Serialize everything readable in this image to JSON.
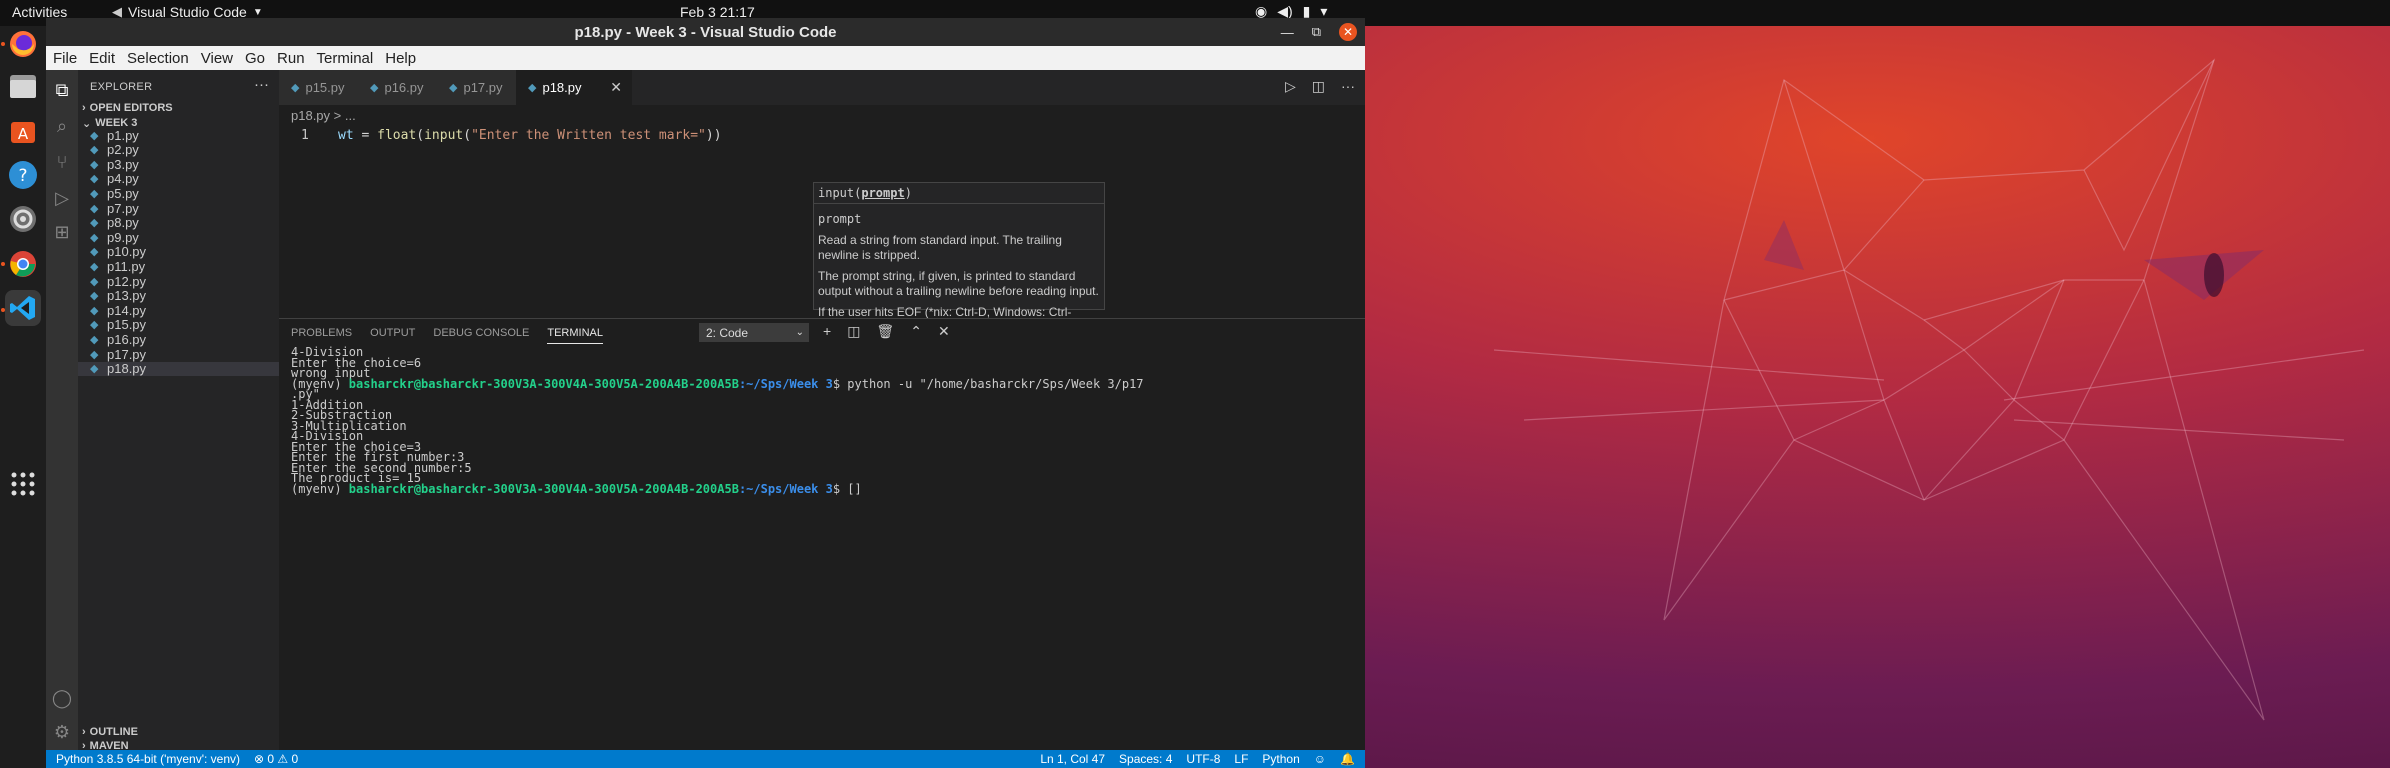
{
  "topbar": {
    "activities": "Activities",
    "app_name": "Visual Studio Code",
    "clock": "Feb 3  21:17"
  },
  "window": {
    "title": "p18.py - Week 3 - Visual Studio Code"
  },
  "menu": [
    "File",
    "Edit",
    "Selection",
    "View",
    "Go",
    "Run",
    "Terminal",
    "Help"
  ],
  "explorer": {
    "header": "EXPLORER",
    "open_editors": "OPEN EDITORS",
    "folder": "WEEK 3",
    "files": [
      "p1.py",
      "p2.py",
      "p3.py",
      "p4.py",
      "p5.py",
      "p7.py",
      "p8.py",
      "p9.py",
      "p10.py",
      "p11.py",
      "p12.py",
      "p13.py",
      "p14.py",
      "p15.py",
      "p16.py",
      "p17.py",
      "p18.py"
    ],
    "selected": "p18.py",
    "outline": "OUTLINE",
    "maven": "MAVEN"
  },
  "tabs": [
    {
      "label": "p15.py",
      "active": false
    },
    {
      "label": "p16.py",
      "active": false
    },
    {
      "label": "p17.py",
      "active": false
    },
    {
      "label": "p18.py",
      "active": true
    }
  ],
  "breadcrumb": "p18.py > ...",
  "editor": {
    "line_number": "1",
    "var": "wt",
    "eq": " = ",
    "fn1": "float",
    "paren1": "(",
    "fn2": "input",
    "paren2": "(",
    "str": "\"Enter the Written test mark=\"",
    "close": "))"
  },
  "hover": {
    "signature_pre": "input(",
    "signature_param": "prompt",
    "signature_post": ")",
    "param_name": "prompt",
    "p1": "Read a string from standard input. The trailing newline is stripped.",
    "p2": "The prompt string, if given, is printed to standard output without a trailing newline before reading input.",
    "p3": "If the user hits EOF (*nix: Ctrl-D, Windows: Ctrl-Z+Return), raise EOFError. On *nix systems, readline is used if available."
  },
  "panel": {
    "tabs": [
      "PROBLEMS",
      "OUTPUT",
      "DEBUG CONSOLE",
      "TERMINAL"
    ],
    "active_tab": "TERMINAL",
    "terminal_select": "2: Code"
  },
  "terminal": {
    "l1": "4-Division",
    "l2": "Enter the choice=6",
    "l3": "wrong input",
    "prompt_env": "(myenv) ",
    "prompt_user": "basharckr@basharckr-300V3A-300V4A-300V5A-200A4B-200A5B",
    "prompt_path": ":~/Sps/Week 3",
    "cmd": "$ python -u \"/home/basharckr/Sps/Week 3/p17",
    "cmd_cont": ".py\"",
    "l5": "1-Addition",
    "l6": "2-Substraction",
    "l7": "3-Multiplication",
    "l8": "4-Division",
    "l9": "Enter the choice=3",
    "l10": "Enter the first number:3",
    "l11": "Enter the second number:5",
    "l12": "The product is= 15",
    "last_prompt_tail": "$ []"
  },
  "status": {
    "interpreter": "Python 3.8.5 64-bit ('myenv': venv)",
    "problems": "⊗ 0 ⚠ 0",
    "position": "Ln 1, Col 47",
    "spaces": "Spaces: 4",
    "encoding": "UTF-8",
    "eol": "LF",
    "language": "Python"
  },
  "colors": {
    "accent": "#007acc",
    "ubuntu_orange": "#e95420"
  }
}
